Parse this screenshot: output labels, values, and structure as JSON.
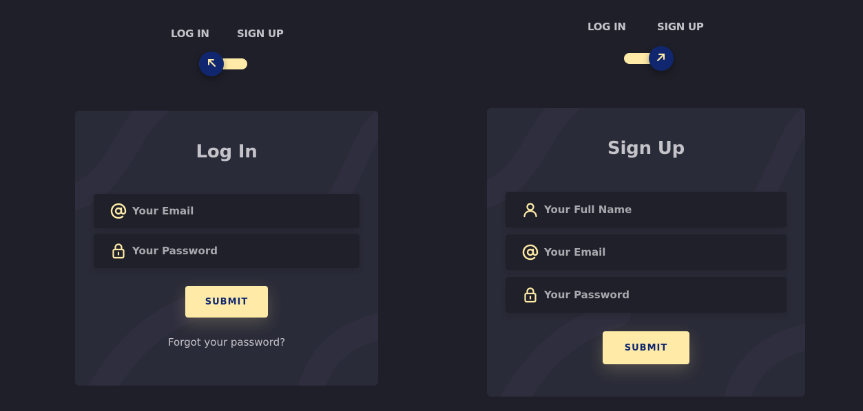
{
  "colors": {
    "page_background": "#1f1f29",
    "card_background": "#2a2b38",
    "field_background": "#1f2029",
    "accent_yellow": "#ffeba7",
    "accent_navy": "#102770",
    "text": "#c4c3ca"
  },
  "login_panel": {
    "toggle": {
      "login_label": "LOG IN",
      "signup_label": "SIGN UP",
      "state": "login",
      "knob_icon": "arrow-up-left-icon"
    },
    "card": {
      "title": "Log In",
      "email": {
        "placeholder": "Your Email",
        "value": "",
        "icon": "at-sign-icon"
      },
      "password": {
        "placeholder": "Your Password",
        "value": "",
        "icon": "lock-icon"
      },
      "submit_label": "SUBMIT",
      "forgot_label": "Forgot your password?"
    }
  },
  "signup_panel": {
    "toggle": {
      "login_label": "LOG IN",
      "signup_label": "SIGN UP",
      "state": "signup",
      "knob_icon": "arrow-up-right-icon"
    },
    "card": {
      "title": "Sign Up",
      "full_name": {
        "placeholder": "Your Full Name",
        "value": "",
        "icon": "user-icon"
      },
      "email": {
        "placeholder": "Your Email",
        "value": "",
        "icon": "at-sign-icon"
      },
      "password": {
        "placeholder": "Your Password",
        "value": "",
        "icon": "lock-icon"
      },
      "submit_label": "SUBMIT"
    }
  }
}
